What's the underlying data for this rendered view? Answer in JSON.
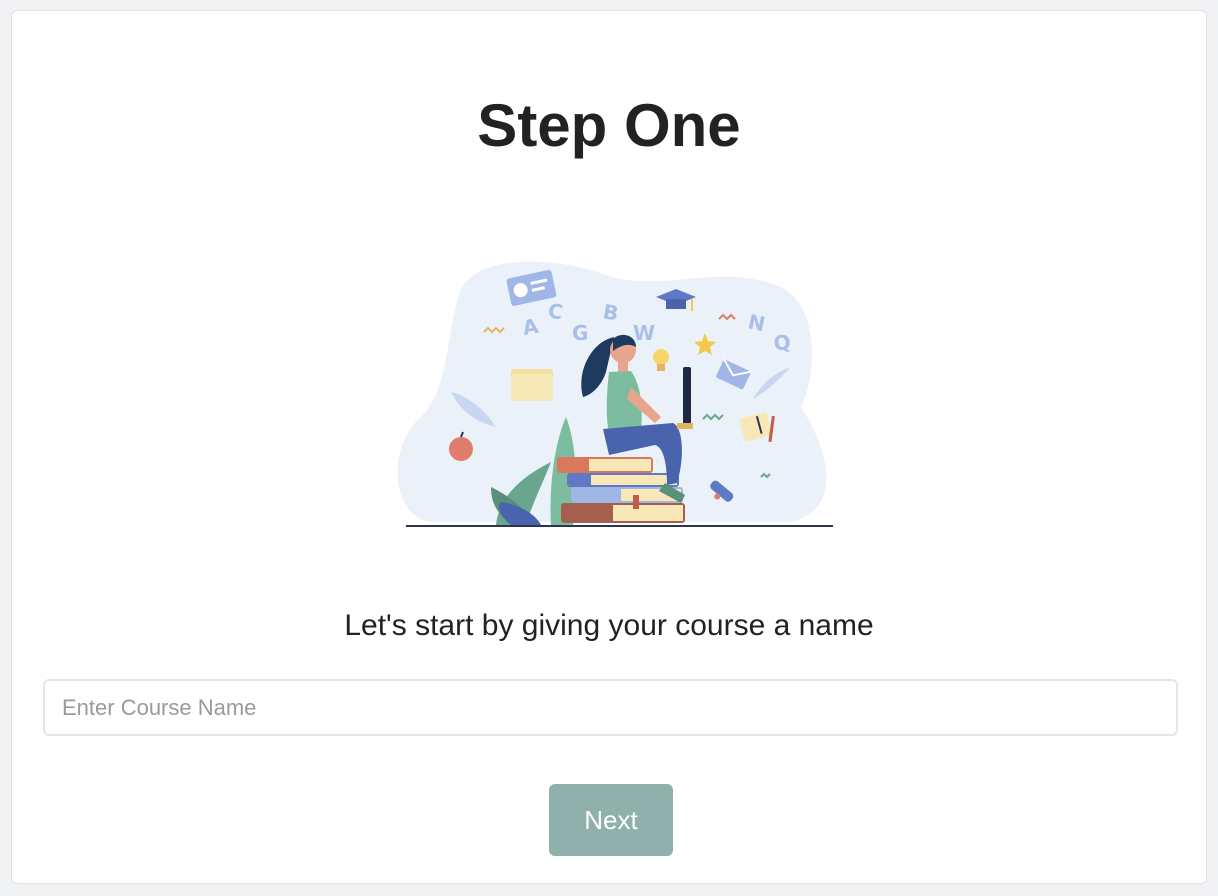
{
  "page": {
    "title": "Step One",
    "prompt": "Let's start by giving your course a name"
  },
  "course_name_input": {
    "value": "",
    "placeholder": "Enter Course Name"
  },
  "next_button": {
    "label": "Next"
  },
  "illustration": {
    "letters": [
      "A",
      "C",
      "G",
      "B",
      "W",
      "N",
      "Q"
    ]
  },
  "colors": {
    "page_background": "#f0f2f4",
    "card_background": "#ffffff",
    "button_background": "#8fb0ab",
    "button_text": "#ffffff",
    "illustration_blob": "#ebf1f8",
    "accent_blue": "#9fb6e6"
  }
}
